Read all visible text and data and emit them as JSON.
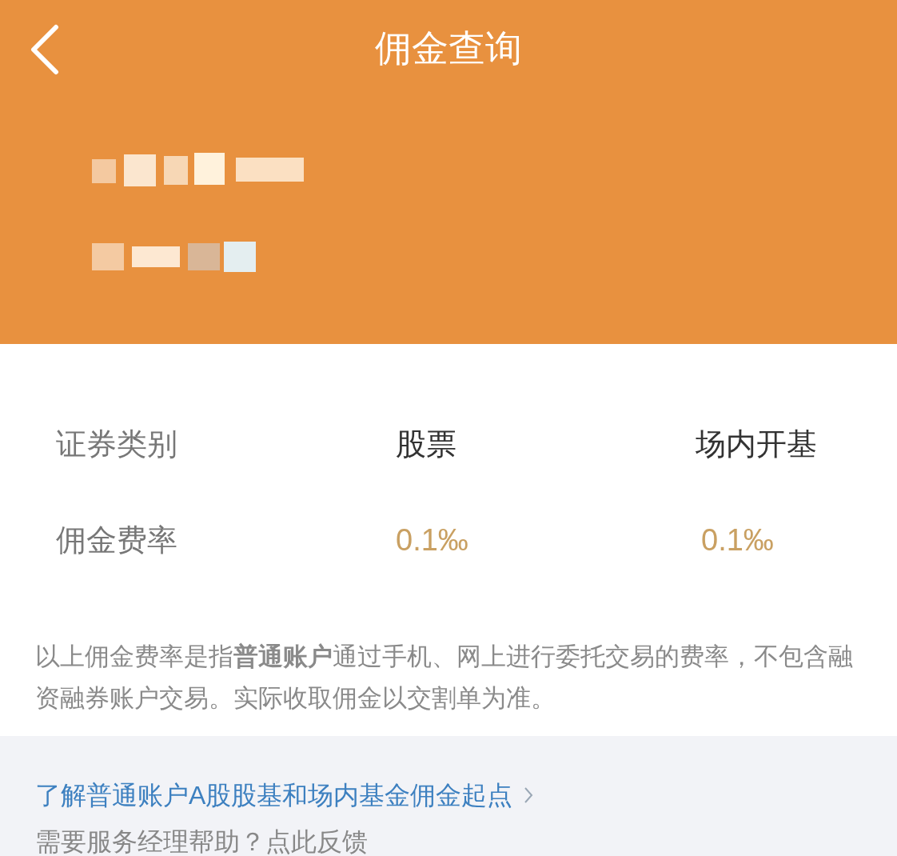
{
  "header": {
    "title": "佣金查询"
  },
  "table": {
    "rows": [
      {
        "label": "证券类别",
        "values": [
          "股票",
          "场内开基"
        ],
        "kind": "type"
      },
      {
        "label": "佣金费率",
        "values": [
          "0.1‰",
          "0.1‰"
        ],
        "kind": "rate"
      }
    ]
  },
  "note": "以上佣金费率是指**普通账户**通过手机、网上进行委托交易的费率，不包含融资融券账户交易。实际收取佣金以交割单为准。",
  "links": [
    {
      "text": "了解普通账户A股股基和场内基金佣金起点",
      "kind": "link"
    },
    {
      "text": "需要服务经理帮助？点此反馈",
      "kind": "plain"
    }
  ]
}
